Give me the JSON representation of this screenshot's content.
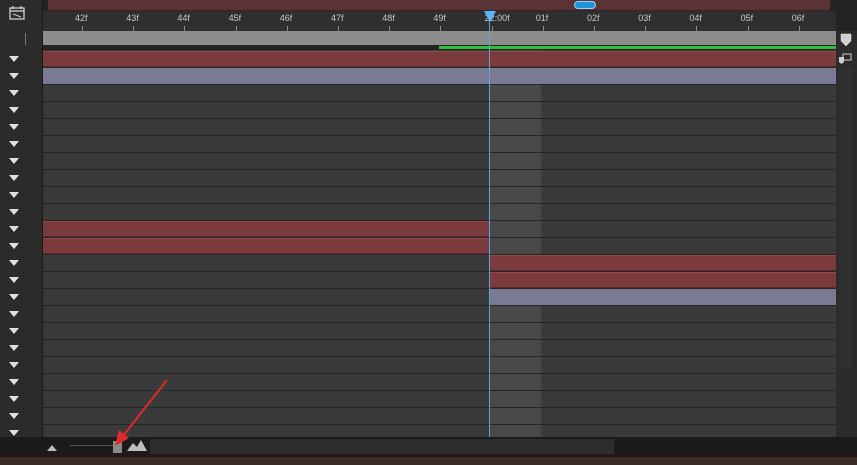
{
  "timeline": {
    "ruler_labels": [
      "42f",
      "43f",
      "44f",
      "45f",
      "46f",
      "47f",
      "48f",
      "49f",
      "22:00f",
      "01f",
      "02f",
      "03f",
      "04f",
      "05f",
      "06f"
    ],
    "current_time_label": "22:00f"
  },
  "colors": {
    "layer_bar_red": "#7b3b3d",
    "layer_bar_lavender": "#7a7a92",
    "work_area": "#8c8c8c",
    "render_bar": "#2fbf3a",
    "playhead": "#4fa6e6",
    "nav_bar": "#5a3335"
  },
  "icons": {
    "composition": "composition-icon",
    "collapse": "triangle-down-icon",
    "zoom_small": "small-mountain-icon",
    "zoom_large": "large-mountain-icon",
    "work_area_end": "marker-icon",
    "comp_marker": "comp-marker-icon"
  },
  "layer_count": 23
}
